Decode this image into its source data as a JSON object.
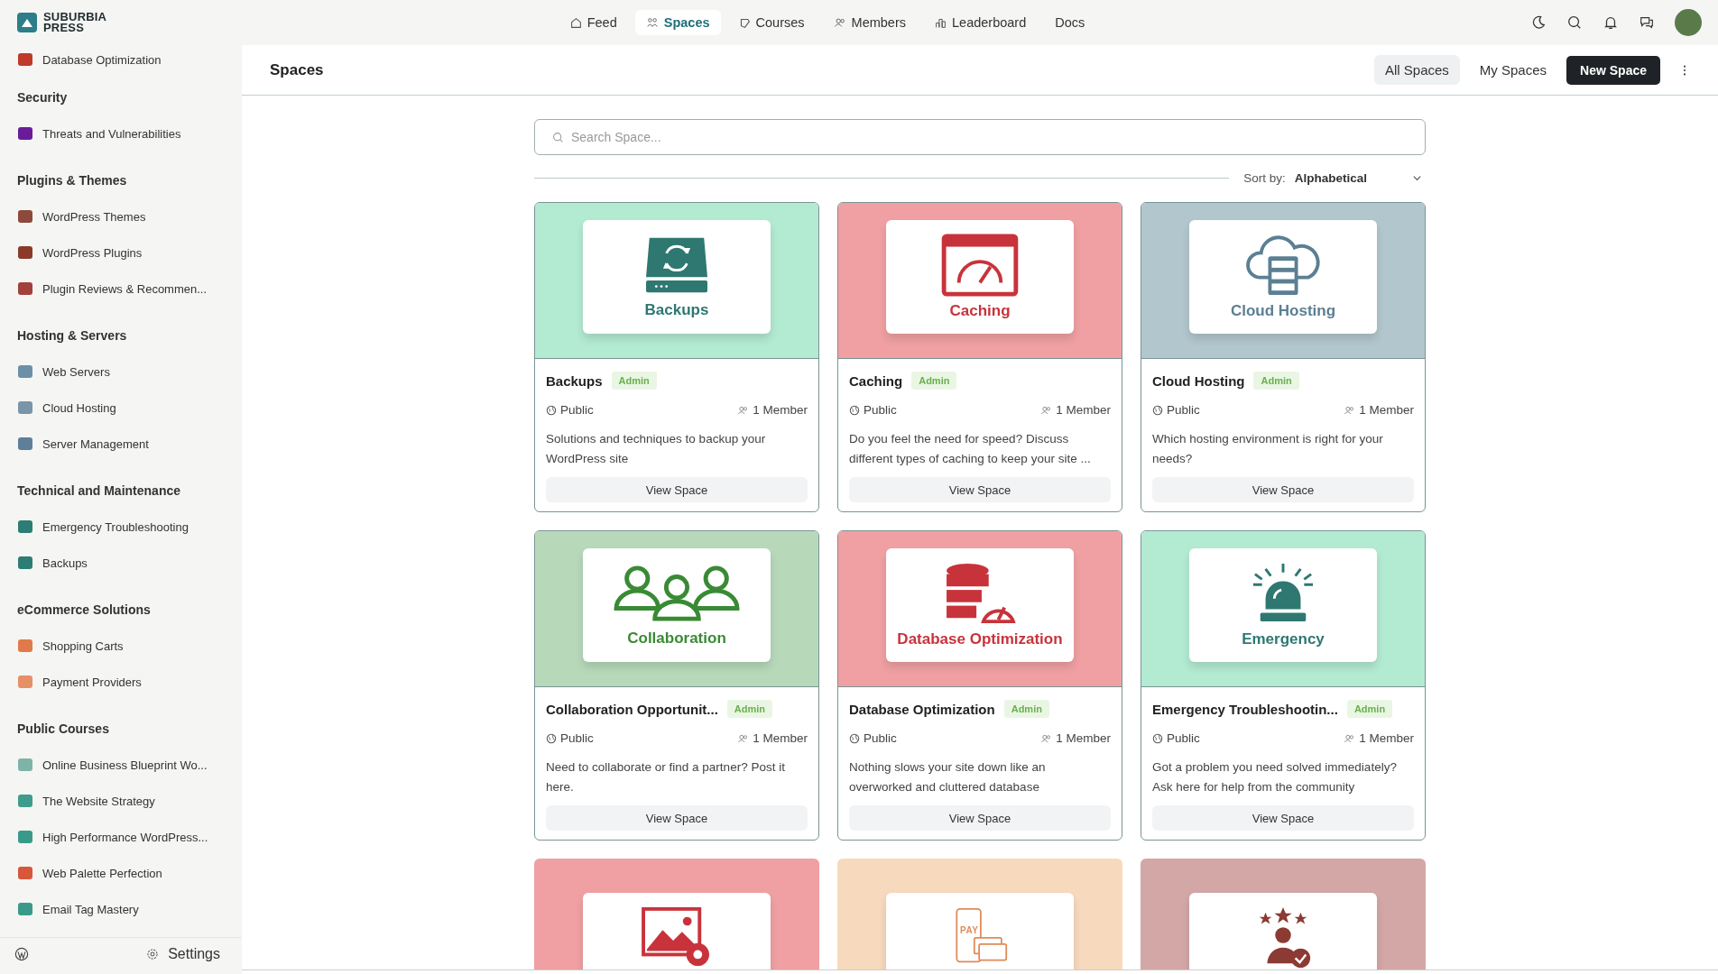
{
  "brand": {
    "name_line_1": "SUBURBIA",
    "name_line_2": "PRESS"
  },
  "top_nav": [
    {
      "label": "Feed",
      "kind": "home",
      "selected": false
    },
    {
      "label": "Spaces",
      "kind": "spaces",
      "selected": true
    },
    {
      "label": "Courses",
      "kind": "courses",
      "selected": false
    },
    {
      "label": "Members",
      "kind": "members",
      "selected": false
    },
    {
      "label": "Leaderboard",
      "kind": "leaderboard",
      "selected": false
    },
    {
      "label": "Docs",
      "kind": "none",
      "selected": false
    }
  ],
  "sidebar": {
    "groups": [
      {
        "items": [
          {
            "label": "Database Optimization",
            "color": "#c0392b"
          }
        ]
      },
      {
        "title": "Security",
        "items": [
          {
            "label": "Threats and Vulnerabilities",
            "color": "#6a1b9a"
          }
        ]
      },
      {
        "title": "Plugins & Themes",
        "items": [
          {
            "label": "WordPress Themes",
            "color": "#8d4a3c"
          },
          {
            "label": "WordPress Plugins",
            "color": "#8b3a2a"
          },
          {
            "label": "Plugin Reviews & Recommen...",
            "color": "#a0413a"
          }
        ]
      },
      {
        "title": "Hosting & Servers",
        "items": [
          {
            "label": "Web Servers",
            "color": "#6d8fa8"
          },
          {
            "label": "Cloud Hosting",
            "color": "#7a95a8"
          },
          {
            "label": "Server Management",
            "color": "#5f7f99"
          }
        ]
      },
      {
        "title": "Technical and Maintenance",
        "items": [
          {
            "label": "Emergency Troubleshooting",
            "color": "#2e7d74"
          },
          {
            "label": "Backups",
            "color": "#2e7d74"
          }
        ]
      },
      {
        "title": "eCommerce Solutions",
        "items": [
          {
            "label": "Shopping Carts",
            "color": "#e07a4a"
          },
          {
            "label": "Payment Providers",
            "color": "#e59067"
          }
        ]
      },
      {
        "title": "Public Courses",
        "items": [
          {
            "label": "Online Business Blueprint Wo...",
            "color": "#7fb3a8"
          },
          {
            "label": "The Website Strategy",
            "color": "#3f9c8c"
          },
          {
            "label": "High Performance WordPress...",
            "color": "#3a9a8a"
          },
          {
            "label": "Web Palette Perfection",
            "color": "#d8563a"
          },
          {
            "label": "Email Tag Mastery",
            "color": "#3a9a8a"
          }
        ]
      }
    ],
    "footer_settings": "Settings"
  },
  "header": {
    "title": "Spaces",
    "tabs": [
      {
        "label": "All Spaces",
        "selected": true
      },
      {
        "label": "My Spaces",
        "selected": false
      }
    ],
    "new_button": "New Space"
  },
  "search": {
    "placeholder": "Search Space..."
  },
  "sort": {
    "label": "Sort by:",
    "value": "Alphabetical"
  },
  "cards": [
    {
      "kind": "backup",
      "color": "#b3ead2",
      "banner_label": "Backups",
      "title": "Backups",
      "badge": "Admin",
      "privacy": "Public",
      "members": "1 Member",
      "description": "Solutions and techniques to backup your WordPress site",
      "button": "View Space"
    },
    {
      "kind": "caching",
      "color": "#f0a0a2",
      "banner_label": "Caching",
      "title": "Caching",
      "badge": "Admin",
      "privacy": "Public",
      "members": "1 Member",
      "description": "Do you feel the need for speed? Discuss different types of caching to keep your site ...",
      "button": "View Space"
    },
    {
      "kind": "cloud",
      "color": "#b2c6cd",
      "banner_label": "Cloud Hosting",
      "title": "Cloud Hosting",
      "badge": "Admin",
      "privacy": "Public",
      "members": "1 Member",
      "description": "Which hosting environment is right for your needs?",
      "button": "View Space"
    },
    {
      "kind": "people",
      "color": "#b7d9ba",
      "banner_label": "Collaboration",
      "title": "Collaboration Opportunit...",
      "badge": "Admin",
      "privacy": "Public",
      "members": "1 Member",
      "description": "Need to collaborate or find a partner? Post it here.",
      "button": "View Space"
    },
    {
      "kind": "database",
      "color": "#f0a0a2",
      "banner_label": "Database Optimization",
      "title": "Database Optimization",
      "badge": "Admin",
      "privacy": "Public",
      "members": "1 Member",
      "description": "Nothing slows your site down like an overworked and cluttered database",
      "button": "View Space"
    },
    {
      "kind": "siren",
      "color": "#b3ead2",
      "banner_label": "Emergency",
      "title": "Emergency Troubleshootin...",
      "badge": "Admin",
      "privacy": "Public",
      "members": "1 Member",
      "description": "Got a problem you need solved immediately? Ask here for help from the community",
      "button": "View Space"
    },
    {
      "kind": "image",
      "color": "#f0a0a2"
    },
    {
      "kind": "pay",
      "color": "#f7d9bd",
      "banner_label": "PAY"
    },
    {
      "kind": "rating",
      "color": "#d3a7a5"
    }
  ]
}
